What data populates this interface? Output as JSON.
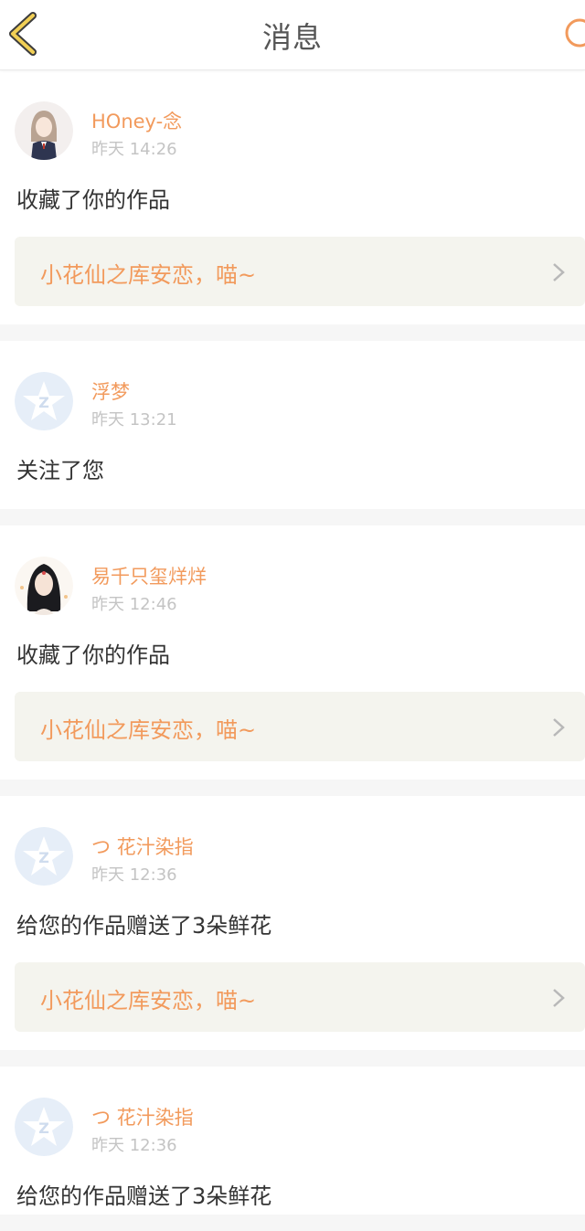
{
  "header": {
    "title": "消息",
    "back_icon": "back-chevron-icon",
    "refresh_icon": "refresh-icon",
    "accent": "#e8c547"
  },
  "colors": {
    "username": "#f29a5c",
    "timestamp": "#c4c4c4",
    "action_text": "#333333",
    "link_box_bg": "#f4f4ee",
    "page_bg": "#f6f6f6"
  },
  "messages": [
    {
      "username": "HOney-念",
      "time": "昨天 14:26",
      "action": "收藏了你的作品",
      "work_title": "小花仙之库安恋，喵~",
      "avatar": "anime-girl-avatar"
    },
    {
      "username": "浮梦",
      "time": "昨天 13:21",
      "action": "关注了您",
      "avatar": "default-qzone-avatar"
    },
    {
      "username": "易千只玺烊烊",
      "time": "昨天 12:46",
      "action": "收藏了你的作品",
      "work_title": "小花仙之库安恋，喵~",
      "avatar": "ancient-girl-avatar"
    },
    {
      "username": "つ 花汁染指",
      "time": "昨天 12:36",
      "action": "给您的作品赠送了3朵鲜花",
      "work_title": "小花仙之库安恋，喵~",
      "avatar": "default-qzone-avatar"
    },
    {
      "username": "つ 花汁染指",
      "time": "昨天 12:36",
      "action": "给您的作品赠送了3朵鲜花",
      "avatar": "default-qzone-avatar"
    }
  ]
}
